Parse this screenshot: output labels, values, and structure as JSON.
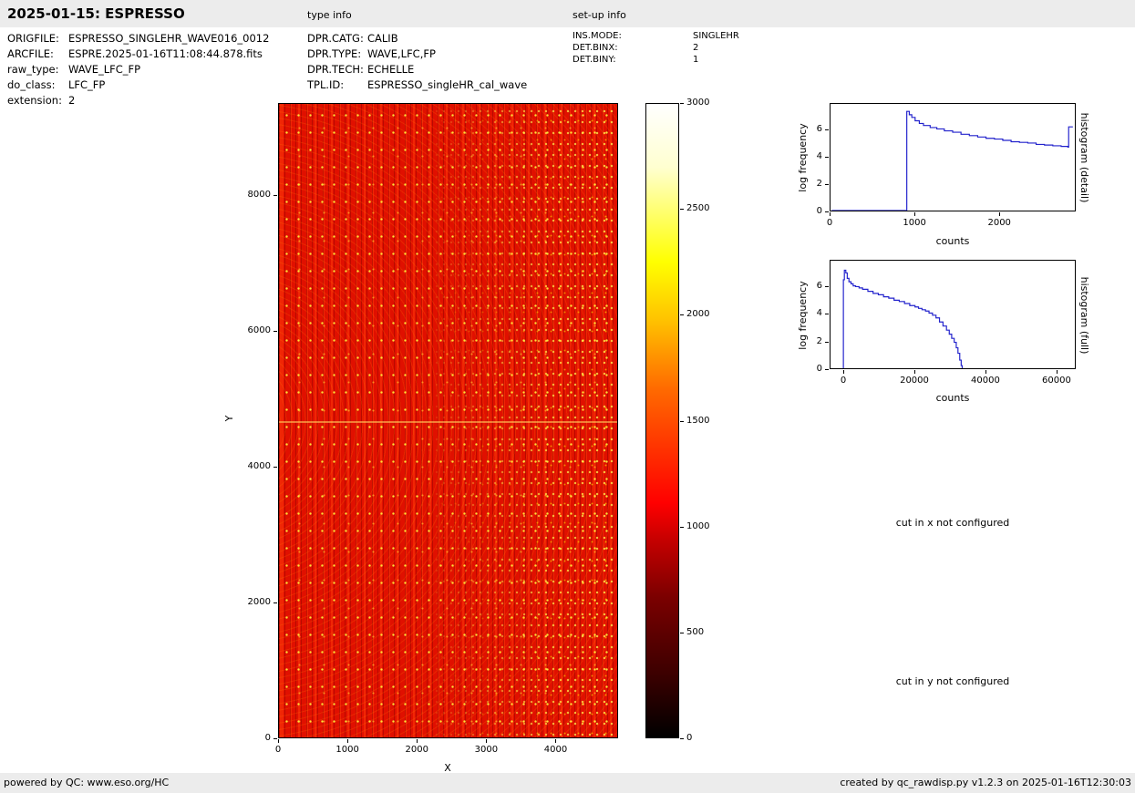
{
  "header": {
    "title": "2025-01-15: ESPRESSO",
    "type_info_label": "type info",
    "setup_info_label": "set-up info"
  },
  "file_info": {
    "rows": [
      {
        "label": "ORIGFILE:",
        "value": "ESPRESSO_SINGLEHR_WAVE016_0012"
      },
      {
        "label": "ARCFILE:",
        "value": "ESPRE.2025-01-16T11:08:44.878.fits"
      },
      {
        "label": "raw_type:",
        "value": "WAVE_LFC_FP"
      },
      {
        "label": "do_class:",
        "value": "LFC_FP"
      },
      {
        "label": "extension:",
        "value": "2"
      }
    ]
  },
  "type_info": {
    "rows": [
      {
        "label": "DPR.CATG:",
        "value": "CALIB"
      },
      {
        "label": "DPR.TYPE:",
        "value": "WAVE,LFC,FP"
      },
      {
        "label": "DPR.TECH:",
        "value": "ECHELLE"
      },
      {
        "label": "TPL.ID:",
        "value": "ESPRESSO_singleHR_cal_wave"
      }
    ]
  },
  "setup_info": {
    "rows": [
      {
        "label": "INS.MODE:",
        "value": "SINGLEHR"
      },
      {
        "label": "DET.BINX:",
        "value": "2"
      },
      {
        "label": "DET.BINY:",
        "value": "1"
      }
    ]
  },
  "annotations": {
    "cut_x": "cut in x not configured",
    "cut_y": "cut in y not configured"
  },
  "footer": {
    "left": "powered by QC: www.eso.org/HC",
    "right": "created by qc_rawdisp.py v1.2.3 on 2025-01-16T12:30:03"
  },
  "chart_data": [
    {
      "id": "raw-image",
      "type": "heatmap",
      "title": "",
      "xlabel": "X",
      "ylabel": "Y",
      "xlim": [
        0,
        4900
      ],
      "ylim": [
        0,
        9350
      ],
      "x_ticks": [
        0,
        1000,
        2000,
        3000,
        4000
      ],
      "y_ticks": [
        0,
        2000,
        4000,
        6000,
        8000
      ],
      "colormap": "hot",
      "colorbar": {
        "vmin": 0,
        "vmax": 3000,
        "ticks": [
          0,
          500,
          1000,
          1500,
          2000,
          2500,
          3000
        ]
      }
    },
    {
      "id": "hist-detail",
      "type": "line",
      "step": true,
      "xlabel": "counts",
      "ylabel": "log frequency",
      "right_label": "histogram (detail)",
      "xlim": [
        0,
        2900
      ],
      "ylim": [
        0,
        7.9
      ],
      "x_ticks": [
        0,
        1000,
        2000
      ],
      "y_ticks": [
        0,
        2,
        4,
        6
      ],
      "line_color": "#2222cc",
      "series": [
        {
          "name": "pixel value histogram (detail)",
          "x": [
            0,
            900,
            900,
            930,
            960,
            1000,
            1050,
            1100,
            1180,
            1260,
            1350,
            1450,
            1550,
            1650,
            1750,
            1850,
            1950,
            2050,
            2150,
            2250,
            2350,
            2450,
            2550,
            2650,
            2750,
            2830,
            2840,
            2890
          ],
          "y": [
            0,
            0,
            7.35,
            7.1,
            6.9,
            6.65,
            6.45,
            6.3,
            6.15,
            6.05,
            5.9,
            5.8,
            5.65,
            5.55,
            5.45,
            5.35,
            5.3,
            5.2,
            5.1,
            5.05,
            5.0,
            4.9,
            4.85,
            4.8,
            4.75,
            4.7,
            6.2,
            6.2
          ]
        }
      ]
    },
    {
      "id": "hist-full",
      "type": "line",
      "step": true,
      "xlabel": "counts",
      "ylabel": "log frequency",
      "right_label": "histogram (full)",
      "xlim": [
        -3850,
        65400
      ],
      "ylim": [
        0,
        7.9
      ],
      "x_ticks": [
        0,
        20000,
        40000,
        60000
      ],
      "y_ticks": [
        0,
        2,
        4,
        6
      ],
      "line_color": "#2222cc",
      "series": [
        {
          "name": "pixel value histogram (full)",
          "x": [
            -600,
            -500,
            -200,
            200,
            600,
            1100,
            1700,
            2300,
            3000,
            4000,
            5000,
            6500,
            8000,
            9500,
            11000,
            12500,
            14000,
            15500,
            17000,
            18500,
            20000,
            21000,
            22000,
            23000,
            24000,
            25000,
            26000,
            27000,
            28000,
            29000,
            29800,
            30500,
            31200,
            31800,
            32300,
            32800,
            33200,
            33500
          ],
          "y": [
            0,
            6.5,
            7.2,
            7.0,
            6.6,
            6.35,
            6.2,
            6.05,
            6.0,
            5.9,
            5.8,
            5.65,
            5.5,
            5.4,
            5.25,
            5.15,
            5.0,
            4.9,
            4.75,
            4.6,
            4.5,
            4.4,
            4.3,
            4.2,
            4.05,
            3.9,
            3.7,
            3.4,
            3.1,
            2.8,
            2.5,
            2.2,
            1.9,
            1.5,
            1.1,
            0.6,
            0.2,
            0
          ]
        }
      ]
    }
  ]
}
